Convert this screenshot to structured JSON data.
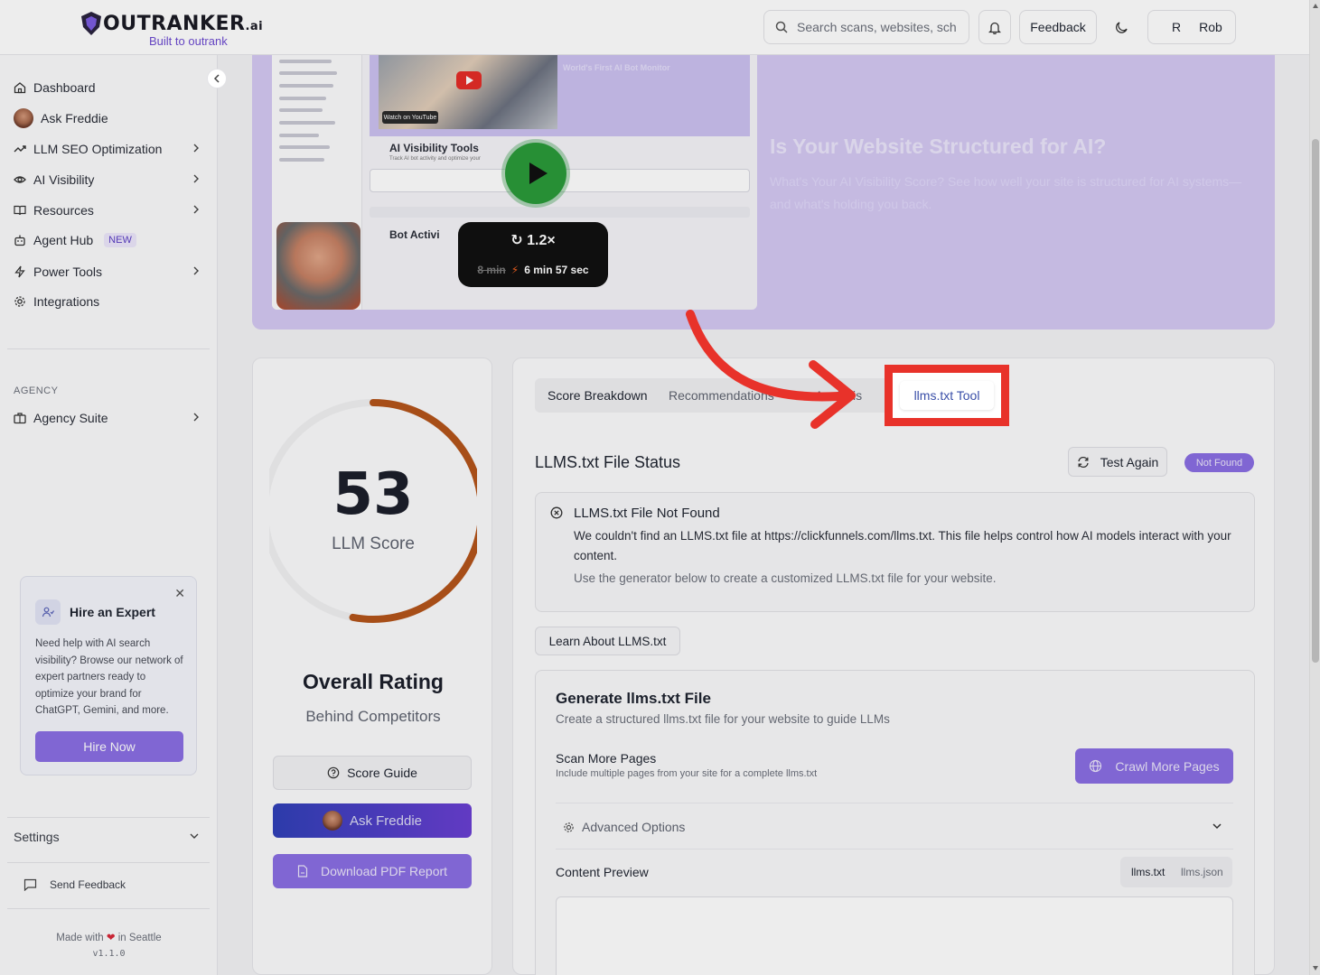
{
  "header": {
    "brand": "OUTRANKER",
    "brand_suffix": ".ai",
    "tagline": "Built to outrank",
    "search_placeholder": "Search scans, websites, sch",
    "feedback_label": "Feedback",
    "user_initial": "R",
    "user_name": "Rob"
  },
  "sidebar": {
    "items": [
      {
        "label": "Dashboard",
        "icon": "home-icon"
      },
      {
        "label": "Ask Freddie",
        "icon": "avatar"
      },
      {
        "label": "LLM SEO Optimization",
        "icon": "trend-icon"
      },
      {
        "label": "AI Visibility",
        "icon": "eye-icon"
      },
      {
        "label": "Resources",
        "icon": "book-icon"
      },
      {
        "label": "Agent Hub",
        "icon": "bot-icon",
        "badge": "NEW"
      },
      {
        "label": "Power Tools",
        "icon": "zap-icon"
      },
      {
        "label": "Integrations",
        "icon": "gear-icon"
      }
    ],
    "agency_label": "AGENCY",
    "agency_item": "Agency Suite",
    "expert": {
      "title": "Hire an Expert",
      "desc": "Need help with AI search visibility? Browse our network of expert partners ready to optimize your brand for ChatGPT, Gemini, and more.",
      "button": "Hire Now"
    },
    "settings_label": "Settings",
    "send_feedback": "Send Feedback",
    "made_prefix": "Made with",
    "made_suffix": "in Seattle",
    "version": "v1.1.0"
  },
  "banner": {
    "video": {
      "top_title": "World's First AI Bot Monitor",
      "watch_on": "Watch on YouTube",
      "section_title": "AI Visibility Tools",
      "section_sub": "Track AI bot activity and optimize your",
      "bot_title": "Bot Activi",
      "speed": "1.2×",
      "old_time": "8 min",
      "new_time": "6 min 57 sec"
    },
    "title": "Is Your Website Structured for AI?",
    "subtitle": "What's Your AI Visibility Score? See how well your site is structured for AI systems—and what's holding you back."
  },
  "score_card": {
    "score": "53",
    "score_label": "LLM Score",
    "score_fraction": 0.53,
    "rating_title": "Overall Rating",
    "rating_sub": "Behind Competitors",
    "guide_button": "Score Guide",
    "freddie_button": "Ask Freddie",
    "pdf_button": "Download PDF Report",
    "accent_color": "#b4541a"
  },
  "main": {
    "tabs": [
      "Score Breakdown",
      "Recommendations",
      "Analysis",
      "llms.txt Tool"
    ],
    "status_title": "LLMS.txt File Status",
    "test_again": "Test Again",
    "not_found_badge": "Not Found",
    "alert": {
      "title": "LLMS.txt File Not Found",
      "desc": "We couldn't find an LLMS.txt file at https://clickfunnels.com/llms.txt. This file helps control how AI models interact with your content.",
      "hint": "Use the generator below to create a customized LLMS.txt file for your website."
    },
    "learn_button": "Learn About LLMS.txt",
    "generate": {
      "title": "Generate llms.txt File",
      "subtitle": "Create a structured llms.txt file for your website to guide LLMs",
      "scan_title": "Scan More Pages",
      "scan_sub": "Include multiple pages from your site for a complete llms.txt",
      "crawl_button": "Crawl More Pages",
      "advanced": "Advanced Options",
      "content_preview": "Content Preview",
      "format_txt": "llms.txt",
      "format_json": "llms.json"
    }
  },
  "colors": {
    "accent": "#8a6ee3",
    "highlight": "#e8322a",
    "gauge": "#b4541a"
  }
}
